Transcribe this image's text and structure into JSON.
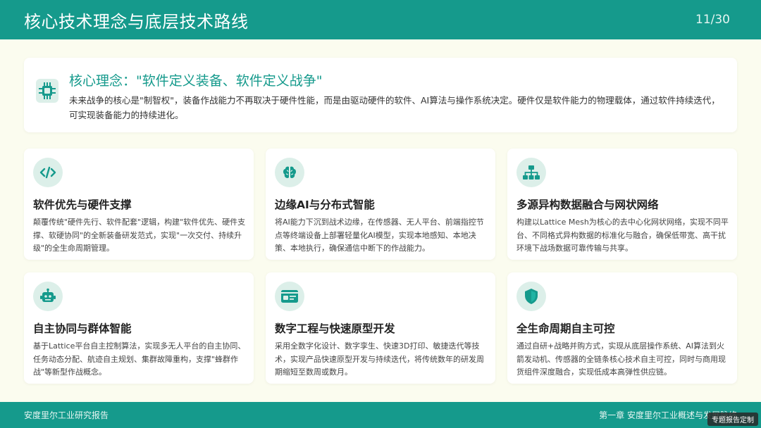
{
  "header": {
    "title": "核心技术理念与底层技术路线",
    "page": "11/30"
  },
  "concept": {
    "icon": "chip-icon",
    "title": "核心理念：\"软件定义装备、软件定义战争\"",
    "text": "未来战争的核心是\"制智权\"，装备作战能力不再取决于硬件性能，而是由驱动硬件的软件、AI算法与操作系统决定。硬件仅是软件能力的物理载体，通过软件持续迭代，可实现装备能力的持续进化。"
  },
  "cards": [
    {
      "icon": "code-icon",
      "title": "软件优先与硬件支撑",
      "text": "颠覆传统\"硬件先行、软件配套\"逻辑，构建\"软件优先、硬件支撑、软硬协同\"的全新装备研发范式，实现\"一次交付、持续升级\"的全生命周期管理。"
    },
    {
      "icon": "brain-icon",
      "title": "边缘AI与分布式智能",
      "text": "将AI能力下沉到战术边缘，在传感器、无人平台、前端指控节点等终端设备上部署轻量化AI模型，实现本地感知、本地决策、本地执行，确保通信中断下的作战能力。"
    },
    {
      "icon": "network-icon",
      "title": "多源异构数据融合与网状网络",
      "text": "构建以Lattice Mesh为核心的去中心化网状网络，实现不同平台、不同格式异构数据的标准化与融合，确保低带宽、高干扰环境下战场数据可靠传输与共享。"
    },
    {
      "icon": "robot-icon",
      "title": "自主协同与群体智能",
      "text": "基于Lattice平台自主控制算法，实现多无人平台的自主协同、任务动态分配、航迹自主规划、集群故障重构，支撑\"蜂群作战\"等新型作战概念。"
    },
    {
      "icon": "id-card-icon",
      "title": "数字工程与快速原型开发",
      "text": "采用全数字化设计、数字孪生、快速3D打印、敏捷迭代等技术，实现产品快速原型开发与持续迭代，将传统数年的研发周期缩短至数周或数月。"
    },
    {
      "icon": "shield-icon",
      "title": "全生命周期自主可控",
      "text": "通过自研+战略并购方式，实现从底层操作系统、AI算法到火箭发动机、传感器的全链条核心技术自主可控，同时与商用现货组件深度融合，实现低成本高弹性供应链。"
    }
  ],
  "footer": {
    "left": "安度里尔工业研究报告",
    "right": "第一章 安度里尔工业概述与发展脉络",
    "badge": "专题报告定制"
  },
  "colors": {
    "accent": "#159a8c",
    "icon_bg": "#dcefe9",
    "background": "#fbfcef"
  }
}
